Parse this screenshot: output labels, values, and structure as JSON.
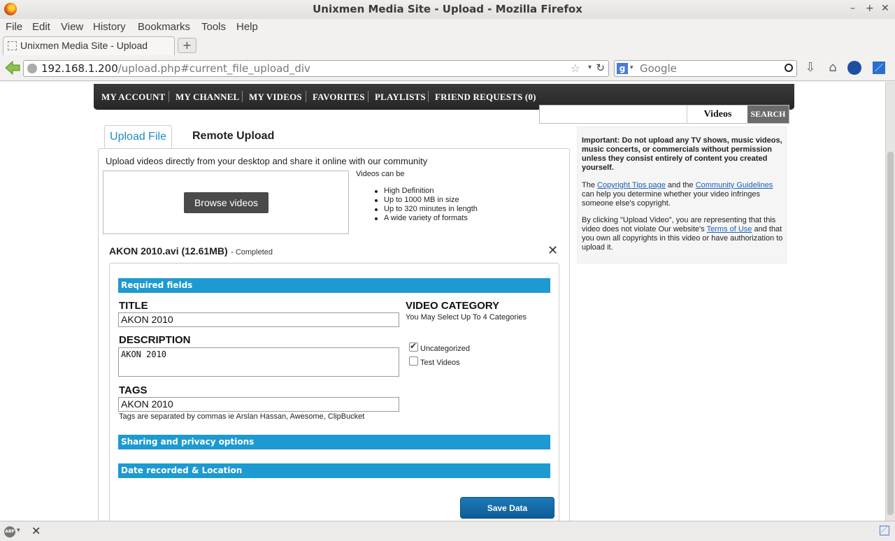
{
  "window": {
    "title": "Unixmen Media Site - Upload - Mozilla Firefox"
  },
  "menu": [
    "File",
    "Edit",
    "View",
    "History",
    "Bookmarks",
    "Tools",
    "Help"
  ],
  "browser_tab": {
    "label": "Unixmen Media Site - Upload",
    "new_tab": "+"
  },
  "address": {
    "host": "192.168.1.200",
    "path": "/upload.php#current_file_upload_div"
  },
  "search_engine": {
    "placeholder": "Google",
    "logo": "g"
  },
  "site_nav": [
    "MY ACCOUNT",
    "MY CHANNEL",
    "MY VIDEOS",
    "FAVORITES",
    "PLAYLISTS",
    "FRIEND REQUESTS (0)"
  ],
  "site_search": {
    "category": "Videos",
    "button": "SEARCH"
  },
  "upload_tabs": [
    "Upload File",
    "Remote Upload"
  ],
  "upload": {
    "intro": "Upload videos directly from your desktop and share it online with our community",
    "browse_label": "Browse videos",
    "videos_can_be": "Videos can be",
    "features": [
      "High Definition",
      "Up to 1000 MB in size",
      "Up to 320 minutes in length",
      "A wide variety of formats"
    ]
  },
  "file": {
    "name": "AKON 2010.avi (12.61MB)",
    "status": "- Completed"
  },
  "form": {
    "required_header": "Required fields",
    "title_label": "TITLE",
    "title_value": "AKON 2010",
    "description_label": "DESCRIPTION",
    "description_value": "AKON 2010",
    "tags_label": "TAGS",
    "tags_value": "AKON 2010",
    "tags_hint": "Tags are separated by commas ie Arslan Hassan, Awesome, ClipBucket",
    "category_label": "VIDEO CATEGORY",
    "category_hint": "You May Select Up To 4 Categories",
    "categories": [
      {
        "label": "Uncategorized",
        "checked": true
      },
      {
        "label": "Test Videos",
        "checked": false
      }
    ],
    "sharing_header": "Sharing and privacy options",
    "date_header": "Date recorded & Location",
    "save_label": "Save Data"
  },
  "sidebar": {
    "important": "Important: Do not upload any TV shows, music videos, music concerts, or commercials without permission unless they consist entirely of content you created yourself.",
    "p2_a": "The ",
    "p2_link1": "Copyright Tips page",
    "p2_b": " and the ",
    "p2_link2": "Community Guidelines",
    "p2_c": " can help you determine whether your video infringes someone else's copyright.",
    "p3_a": "By clicking \"Upload Video\", you are representing that this video does not violate Our website's ",
    "p3_link": "Terms of Use",
    "p3_b": " and that you own all copyrights in this video or have authorization to upload it."
  },
  "status": {
    "abp": "ABP"
  }
}
